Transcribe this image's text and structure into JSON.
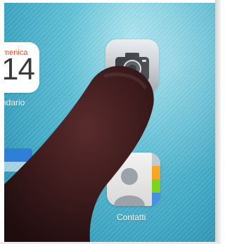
{
  "apps": {
    "calendario": {
      "day_text": "menica",
      "date_text": "14",
      "label": "ndario",
      "accent": "#f0542b"
    },
    "fotocamera": {
      "icon": "camera-icon"
    },
    "contatti": {
      "label": "Contatti",
      "icon": "contacts-icon",
      "tab_colors": [
        "#bfc8d0",
        "#f5a623",
        "#7ed321",
        "#4a90e2"
      ]
    }
  },
  "colors": {
    "wallpaper": "#62c2d8",
    "finger": "#3a1a1b"
  }
}
